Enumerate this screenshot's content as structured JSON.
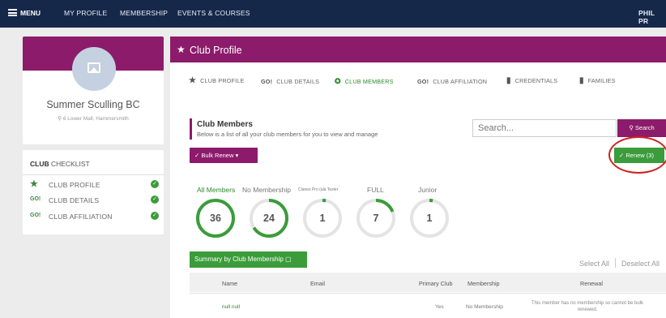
{
  "topbar": {
    "menu": "MENU",
    "my_profile": "MY PROFILE",
    "membership": "MEMBERSHIP",
    "events": "EVENTS & COURSES",
    "user": "PHIL PR"
  },
  "profile": {
    "club_name": "Summer Sculling BC",
    "address": "6 Lower Mall, Hammersmith"
  },
  "checklist": {
    "title_bold": "CLUB",
    "title_rest": " CHECKLIST",
    "items": [
      {
        "icon": "★",
        "label": "CLUB PROFILE"
      },
      {
        "icon": "GO!",
        "label": "CLUB DETAILS"
      },
      {
        "icon": "GO!",
        "label": "CLUB AFFILIATION"
      }
    ]
  },
  "main": {
    "title": "Club Profile",
    "tabs": [
      {
        "icon": "★",
        "label": "CLUB PROFILE"
      },
      {
        "icon": "GO!",
        "label": "CLUB DETAILS"
      },
      {
        "icon": "✪",
        "label": "CLUB MEMBERS"
      },
      {
        "icon": "GO!",
        "label": "CLUB AFFILIATION"
      },
      {
        "icon": "▮",
        "label": "CREDENTIALS"
      },
      {
        "icon": "▮",
        "label": "FAMILIES"
      }
    ],
    "members_title": "Club Members",
    "members_subtitle": "Below is a list of all your club members for you to view and manage",
    "search_placeholder": "Search...",
    "search_button": "Search",
    "bulk_renew": "Bulk Renew",
    "renew_button": "Renew (3)",
    "filters": [
      {
        "label": "All Members",
        "count": "36",
        "fill": 1.0
      },
      {
        "label": "No Membership",
        "count": "24",
        "fill": 0.66
      },
      {
        "label": "Clanes Pro (ala Tester",
        "count": "1",
        "fill": 0.03
      },
      {
        "label": "FULL",
        "count": "7",
        "fill": 0.19
      },
      {
        "label": "Junior",
        "count": "1",
        "fill": 0.03
      }
    ],
    "summary_button": "Summary by Club Membership",
    "select_all": "Select All",
    "deselect_all": "Deselect All",
    "table": {
      "headers": [
        "Name",
        "Email",
        "Primary Club",
        "Membership",
        "Renewal"
      ],
      "rows": [
        {
          "name": "null null",
          "email": "",
          "primary_club": "Yes",
          "membership": "No Membership",
          "renewal": "This member has no membership so cannot be bulk renewed."
        }
      ]
    }
  },
  "colors": {
    "nav": "#16284a",
    "brand": "#8c1b6b",
    "success": "#3a9c3a",
    "highlight": "#d02020"
  }
}
